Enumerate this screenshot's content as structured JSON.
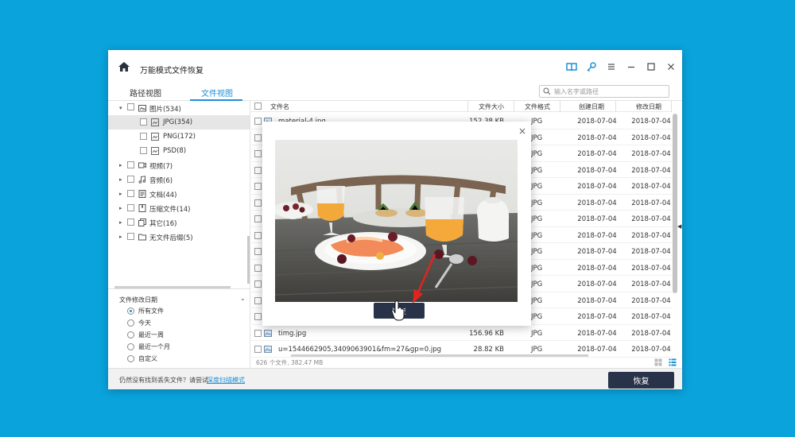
{
  "app": {
    "title": "万能模式文件恢复",
    "accent": "#1e8fd6",
    "dark_button": "#283349",
    "background": "#0aa3dc"
  },
  "titlebar_icons": [
    "book-icon",
    "key-icon",
    "menu-icon",
    "minimize-icon",
    "maximize-icon",
    "close-icon"
  ],
  "tabs": [
    {
      "label": "路径视图",
      "active": false
    },
    {
      "label": "文件视图",
      "active": true
    }
  ],
  "search": {
    "placeholder": "输入名字或路径"
  },
  "tree": [
    {
      "label": "图片(534)",
      "expanded": true,
      "icon": "image-folder-icon"
    },
    {
      "label": "JPG(354)",
      "child": true,
      "selected": true
    },
    {
      "label": "PNG(172)",
      "child": true
    },
    {
      "label": "PSD(8)",
      "child": true
    },
    {
      "label": "视频(7)",
      "icon": "video-icon"
    },
    {
      "label": "音频(6)",
      "icon": "music-icon"
    },
    {
      "label": "文档(44)",
      "icon": "document-icon"
    },
    {
      "label": "压缩文件(14)",
      "icon": "archive-icon"
    },
    {
      "label": "其它(16)",
      "icon": "other-files-icon"
    },
    {
      "label": "无文件后缀(5)",
      "icon": "no-extension-icon"
    }
  ],
  "filter": {
    "title": "文件修改日期",
    "options": [
      {
        "label": "所有文件",
        "selected": true
      },
      {
        "label": "今天",
        "selected": false
      },
      {
        "label": "最近一周",
        "selected": false
      },
      {
        "label": "最近一个月",
        "selected": false
      },
      {
        "label": "自定义",
        "selected": false
      }
    ]
  },
  "table": {
    "headers": {
      "name": "文件名",
      "size": "文件大小",
      "type": "文件格式",
      "created": "创建日期",
      "modified": "修改日期"
    },
    "rows": [
      {
        "name": "material-4.jpg",
        "size": "152.38 KB",
        "type": "JPG",
        "created": "2018-07-04",
        "modified": "2018-07-04"
      },
      {
        "name": "",
        "size": "",
        "type": "JPG",
        "created": "2018-07-04",
        "modified": "2018-07-04"
      },
      {
        "name": "",
        "size": "",
        "type": "JPG",
        "created": "2018-07-04",
        "modified": "2018-07-04"
      },
      {
        "name": "",
        "size": "",
        "type": "JPG",
        "created": "2018-07-04",
        "modified": "2018-07-04"
      },
      {
        "name": "",
        "size": "",
        "type": "JPG",
        "created": "2018-07-04",
        "modified": "2018-07-04"
      },
      {
        "name": "",
        "size": "",
        "type": "JPG",
        "created": "2018-07-04",
        "modified": "2018-07-04"
      },
      {
        "name": "",
        "size": "",
        "type": "JPG",
        "created": "2018-07-04",
        "modified": "2018-07-04"
      },
      {
        "name": "",
        "size": "",
        "type": "JPG",
        "created": "2018-07-04",
        "modified": "2018-07-04"
      },
      {
        "name": "",
        "size": "",
        "type": "JPG",
        "created": "2018-07-04",
        "modified": "2018-07-04"
      },
      {
        "name": "",
        "size": "",
        "type": "JPG",
        "created": "2018-07-04",
        "modified": "2018-07-04"
      },
      {
        "name": "",
        "size": "",
        "type": "JPG",
        "created": "2018-07-04",
        "modified": "2018-07-04"
      },
      {
        "name": "",
        "size": "",
        "type": "JPG",
        "created": "2018-07-04",
        "modified": "2018-07-04"
      },
      {
        "name": "",
        "size": "",
        "type": "JPG",
        "created": "2018-07-04",
        "modified": "2018-07-04"
      },
      {
        "name": "timg.jpg",
        "size": "156.96 KB",
        "type": "JPG",
        "created": "2018-07-04",
        "modified": "2018-07-04"
      },
      {
        "name": "u=1544662905,3409063901&fm=27&gp=0.jpg",
        "size": "28.82 KB",
        "type": "JPG",
        "created": "2018-07-04",
        "modified": "2018-07-04"
      }
    ],
    "footer": "626 个文件, 382.47 MB"
  },
  "bottom": {
    "hint": "仍然没有找到丢失文件？请尝试",
    "link": "深度扫描模式",
    "recover_label": "恢复"
  },
  "popup": {
    "close_label": "×",
    "recover_label": "恢复"
  }
}
